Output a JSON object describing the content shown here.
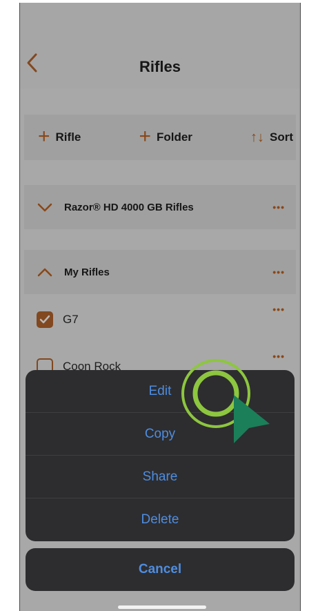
{
  "header": {
    "title": "Rifles",
    "back_icon": "chevron-left-icon"
  },
  "toolbar": {
    "add_rifle_label": "Rifle",
    "add_folder_label": "Folder",
    "sort_label": "Sort",
    "accent_color": "#c06320"
  },
  "sections": [
    {
      "label": "Razor® HD 4000 GB Rifles",
      "expanded": false,
      "more": "•••"
    },
    {
      "label": "My Rifles",
      "expanded": true,
      "more": "•••"
    }
  ],
  "rifles": [
    {
      "name": "G7",
      "checked": true,
      "more": "•••"
    },
    {
      "name": "Coon Rock",
      "checked": false,
      "more": "•••"
    }
  ],
  "action_sheet": {
    "items": [
      "Edit",
      "Copy",
      "Share",
      "Delete"
    ],
    "cancel_label": "Cancel",
    "item_color": "#4e8de1"
  },
  "tap_indicator": {
    "colors": [
      "#8dc63f",
      "#1b7f5a"
    ]
  }
}
